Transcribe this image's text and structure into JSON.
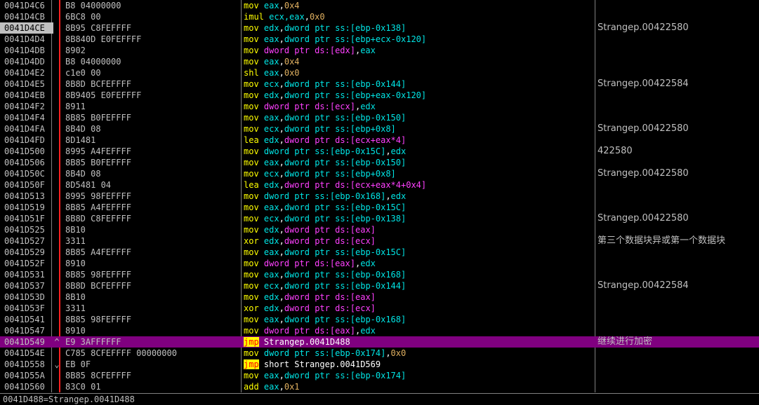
{
  "rows": [
    {
      "addr": "0041D4C6",
      "mark": "",
      "hex": "B8 04000000",
      "mn": "mov",
      "op": "eax",
      "opType": "reg",
      "sep": ",",
      "op2": "0x4",
      "op2Type": "imm",
      "comment": ""
    },
    {
      "addr": "0041D4CB",
      "mark": "",
      "hex": "6BC8 00",
      "mn": "imul",
      "op": "ecx,eax",
      "opType": "reg",
      "sep": ",",
      "op2": "0x0",
      "op2Type": "imm",
      "comment": ""
    },
    {
      "addr": "0041D4CE",
      "mark": "",
      "hex": "8B95 C8FEFFFF",
      "mn": "mov",
      "op": "edx",
      "opType": "reg",
      "sep": ",",
      "op2": "dword ptr ss:[ebp-0x138]",
      "op2Type": "reg",
      "comment": "Strangep.00422580"
    },
    {
      "addr": "0041D4D4",
      "mark": "",
      "hex": "8B840D E0FEFFFF",
      "mn": "mov",
      "op": "eax",
      "opType": "reg",
      "sep": ",",
      "op2": "dword ptr ss:[ebp+ecx-0x120]",
      "op2Type": "reg",
      "comment": ""
    },
    {
      "addr": "0041D4DB",
      "mark": "",
      "hex": "8902",
      "mn": "mov",
      "op": "dword ptr ds:[edx]",
      "opType": "mem",
      "sep": ",",
      "op2": "eax",
      "op2Type": "reg",
      "comment": ""
    },
    {
      "addr": "0041D4DD",
      "mark": "",
      "hex": "B8 04000000",
      "mn": "mov",
      "op": "eax",
      "opType": "reg",
      "sep": ",",
      "op2": "0x4",
      "op2Type": "imm",
      "comment": ""
    },
    {
      "addr": "0041D4E2",
      "mark": "",
      "hex": "c1e0 00",
      "mn": "shl",
      "op": "eax",
      "opType": "reg",
      "sep": ",",
      "op2": "0x0",
      "op2Type": "imm",
      "comment": ""
    },
    {
      "addr": "0041D4E5",
      "mark": "",
      "hex": "8B8D BCFEFFFF",
      "mn": "mov",
      "op": "ecx",
      "opType": "reg",
      "sep": ",",
      "op2": "dword ptr ss:[ebp-0x144]",
      "op2Type": "reg",
      "comment": "Strangep.00422584"
    },
    {
      "addr": "0041D4EB",
      "mark": "",
      "hex": "8B9405 E0FEFFFF",
      "mn": "mov",
      "op": "edx",
      "opType": "reg",
      "sep": ",",
      "op2": "dword ptr ss:[ebp+eax-0x120]",
      "op2Type": "reg",
      "comment": ""
    },
    {
      "addr": "0041D4F2",
      "mark": "",
      "hex": "8911",
      "mn": "mov",
      "op": "dword ptr ds:[ecx]",
      "opType": "mem",
      "sep": ",",
      "op2": "edx",
      "op2Type": "reg",
      "comment": ""
    },
    {
      "addr": "0041D4F4",
      "mark": "",
      "hex": "8B85 B0FEFFFF",
      "mn": "mov",
      "op": "eax",
      "opType": "reg",
      "sep": ",",
      "op2": "dword ptr ss:[ebp-0x150]",
      "op2Type": "reg",
      "comment": ""
    },
    {
      "addr": "0041D4FA",
      "mark": "",
      "hex": "8B4D 08",
      "mn": "mov",
      "op": "ecx",
      "opType": "reg",
      "sep": ",",
      "op2": "dword ptr ss:[ebp+0x8]",
      "op2Type": "reg",
      "comment": "Strangep.00422580"
    },
    {
      "addr": "0041D4FD",
      "mark": "",
      "hex": "8D1481",
      "mn": "lea",
      "op": "edx",
      "opType": "reg",
      "sep": ",",
      "op2": "dword ptr ds:[ecx+eax*4]",
      "op2Type": "mem",
      "comment": ""
    },
    {
      "addr": "0041D500",
      "mark": "",
      "hex": "8995 A4FEFFFF",
      "mn": "mov",
      "op": "dword ptr ss:[ebp-0x15C]",
      "opType": "reg",
      "sep": ",",
      "op2": "edx",
      "op2Type": "reg",
      "comment": "422580"
    },
    {
      "addr": "0041D506",
      "mark": "",
      "hex": "8B85 B0FEFFFF",
      "mn": "mov",
      "op": "eax",
      "opType": "reg",
      "sep": ",",
      "op2": "dword ptr ss:[ebp-0x150]",
      "op2Type": "reg",
      "comment": ""
    },
    {
      "addr": "0041D50C",
      "mark": "",
      "hex": "8B4D 08",
      "mn": "mov",
      "op": "ecx",
      "opType": "reg",
      "sep": ",",
      "op2": "dword ptr ss:[ebp+0x8]",
      "op2Type": "reg",
      "comment": "Strangep.00422580"
    },
    {
      "addr": "0041D50F",
      "mark": "",
      "hex": "8D5481 04",
      "mn": "lea",
      "op": "edx",
      "opType": "reg",
      "sep": ",",
      "op2": "dword ptr ds:[ecx+eax*4+0x4]",
      "op2Type": "mem",
      "comment": ""
    },
    {
      "addr": "0041D513",
      "mark": "",
      "hex": "8995 98FEFFFF",
      "mn": "mov",
      "op": "dword ptr ss:[ebp-0x168]",
      "opType": "reg",
      "sep": ",",
      "op2": "edx",
      "op2Type": "reg",
      "comment": ""
    },
    {
      "addr": "0041D519",
      "mark": "",
      "hex": "8B85 A4FEFFFF",
      "mn": "mov",
      "op": "eax",
      "opType": "reg",
      "sep": ",",
      "op2": "dword ptr ss:[ebp-0x15C]",
      "op2Type": "reg",
      "comment": ""
    },
    {
      "addr": "0041D51F",
      "mark": "",
      "hex": "8B8D C8FEFFFF",
      "mn": "mov",
      "op": "ecx",
      "opType": "reg",
      "sep": ",",
      "op2": "dword ptr ss:[ebp-0x138]",
      "op2Type": "reg",
      "comment": "Strangep.00422580"
    },
    {
      "addr": "0041D525",
      "mark": "",
      "hex": "8B10",
      "mn": "mov",
      "op": "edx",
      "opType": "reg",
      "sep": ",",
      "op2": "dword ptr ds:[eax]",
      "op2Type": "mem",
      "comment": ""
    },
    {
      "addr": "0041D527",
      "mark": "",
      "hex": "3311",
      "mn": "xor",
      "op": "edx",
      "opType": "reg",
      "sep": ",",
      "op2": "dword ptr ds:[ecx]",
      "op2Type": "mem",
      "comment": "第三个数据块异或第一个数据块"
    },
    {
      "addr": "0041D529",
      "mark": "",
      "hex": "8B85 A4FEFFFF",
      "mn": "mov",
      "op": "eax",
      "opType": "reg",
      "sep": ",",
      "op2": "dword ptr ss:[ebp-0x15C]",
      "op2Type": "reg",
      "comment": ""
    },
    {
      "addr": "0041D52F",
      "mark": "",
      "hex": "8910",
      "mn": "mov",
      "op": "dword ptr ds:[eax]",
      "opType": "mem",
      "sep": ",",
      "op2": "edx",
      "op2Type": "reg",
      "comment": ""
    },
    {
      "addr": "0041D531",
      "mark": "",
      "hex": "8B85 98FEFFFF",
      "mn": "mov",
      "op": "eax",
      "opType": "reg",
      "sep": ",",
      "op2": "dword ptr ss:[ebp-0x168]",
      "op2Type": "reg",
      "comment": ""
    },
    {
      "addr": "0041D537",
      "mark": "",
      "hex": "8B8D BCFEFFFF",
      "mn": "mov",
      "op": "ecx",
      "opType": "reg",
      "sep": ",",
      "op2": "dword ptr ss:[ebp-0x144]",
      "op2Type": "reg",
      "comment": "Strangep.00422584"
    },
    {
      "addr": "0041D53D",
      "mark": "",
      "hex": "8B10",
      "mn": "mov",
      "op": "edx",
      "opType": "reg",
      "sep": ",",
      "op2": "dword ptr ds:[eax]",
      "op2Type": "mem",
      "comment": ""
    },
    {
      "addr": "0041D53F",
      "mark": "",
      "hex": "3311",
      "mn": "xor",
      "op": "edx",
      "opType": "reg",
      "sep": ",",
      "op2": "dword ptr ds:[ecx]",
      "op2Type": "mem",
      "comment": ""
    },
    {
      "addr": "0041D541",
      "mark": "",
      "hex": "8B85 98FEFFFF",
      "mn": "mov",
      "op": "eax",
      "opType": "reg",
      "sep": ",",
      "op2": "dword ptr ss:[ebp-0x168]",
      "op2Type": "reg",
      "comment": ""
    },
    {
      "addr": "0041D547",
      "mark": "",
      "hex": "8910",
      "mn": "mov",
      "op": "dword ptr ds:[eax]",
      "opType": "mem",
      "sep": ",",
      "op2": "edx",
      "op2Type": "reg",
      "comment": ""
    },
    {
      "addr": "0041D549",
      "mark": "^",
      "hex": "E9 3AFFFFFF",
      "mn": "jmp",
      "op": "Strangep.0041D488",
      "opType": "lab",
      "sep": "",
      "op2": "",
      "op2Type": "",
      "comment": "继续进行加密",
      "current": true
    },
    {
      "addr": "0041D54E",
      "mark": "",
      "hex": "C785 8CFEFFFF 00000000",
      "mn": "mov",
      "op": "dword ptr ss:[ebp-0x174]",
      "opType": "reg",
      "sep": ",",
      "op2": "0x0",
      "op2Type": "imm",
      "comment": ""
    },
    {
      "addr": "0041D558",
      "mark": "⌄",
      "hex": "EB 0F",
      "mn": "jmp",
      "op": "short Strangep.0041D569",
      "opType": "lab",
      "sep": "",
      "op2": "",
      "op2Type": "",
      "comment": ""
    },
    {
      "addr": "0041D55A",
      "mark": "",
      "hex": "8B85 8CFEFFFF",
      "mn": "mov",
      "op": "eax",
      "opType": "reg",
      "sep": ",",
      "op2": "dword ptr ss:[ebp-0x174]",
      "op2Type": "reg",
      "comment": ""
    },
    {
      "addr": "0041D560",
      "mark": "",
      "hex": "83C0 01",
      "mn": "add",
      "op": "eax",
      "opType": "reg",
      "sep": ",",
      "op2": "0x1",
      "op2Type": "imm",
      "comment": ""
    }
  ],
  "selected_addr": "0041D4CE",
  "status_text": "0041D488=Strangep.0041D488",
  "colors": {
    "background": "#000000",
    "current_line": "#800080",
    "mnemonic": "#ffff00",
    "register": "#00e5e5",
    "memory": "#ff40ff",
    "immediate": "#e0b060"
  }
}
